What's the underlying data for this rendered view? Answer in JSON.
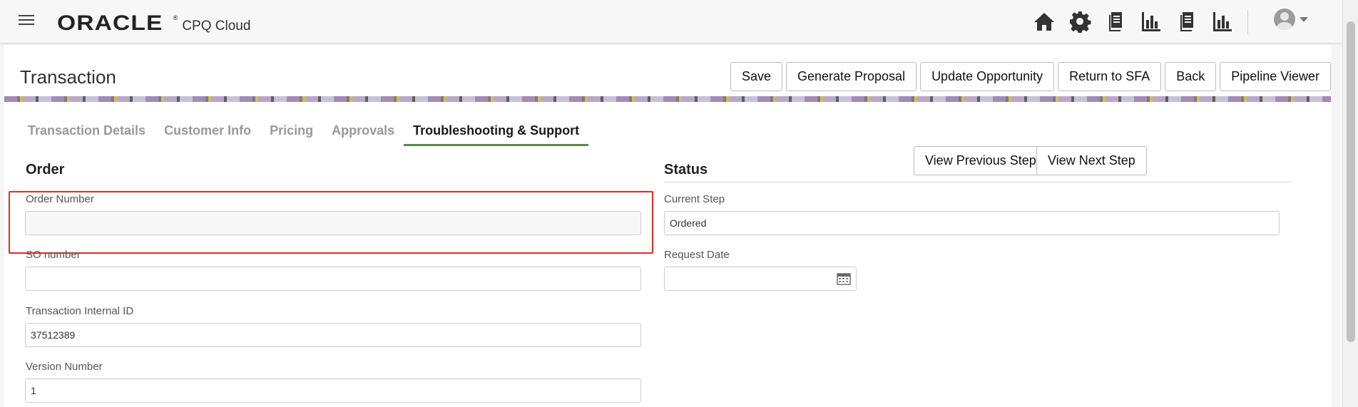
{
  "header": {
    "logo_brand": "ORACLE",
    "logo_reg": "®",
    "logo_product": "CPQ Cloud",
    "icons": [
      "home-icon",
      "gear-icon",
      "documents-icon",
      "bar-chart-icon",
      "documents-icon",
      "bar-chart-icon"
    ]
  },
  "page": {
    "title": "Transaction"
  },
  "actions": {
    "save": "Save",
    "generate_proposal": "Generate Proposal",
    "update_opportunity": "Update Opportunity",
    "return_to_sfa": "Return to SFA",
    "back": "Back",
    "pipeline_viewer": "Pipeline Viewer"
  },
  "tabs": [
    {
      "label": "Transaction Details"
    },
    {
      "label": "Customer Info"
    },
    {
      "label": "Pricing"
    },
    {
      "label": "Approvals"
    },
    {
      "label": "Troubleshooting & Support",
      "active": true
    }
  ],
  "order": {
    "title": "Order",
    "order_number_label": "Order Number",
    "order_number_value": "",
    "so_number_label": "SO number",
    "so_number_value": "",
    "internal_id_label": "Transaction Internal ID",
    "internal_id_value": "37512389",
    "version_label": "Version Number",
    "version_value": "1"
  },
  "status": {
    "title": "Status",
    "view_previous": "View Previous Step",
    "view_next": "View Next Step",
    "current_step_label": "Current Step",
    "current_step_value": "Ordered",
    "request_date_label": "Request Date",
    "request_date_value": ""
  }
}
